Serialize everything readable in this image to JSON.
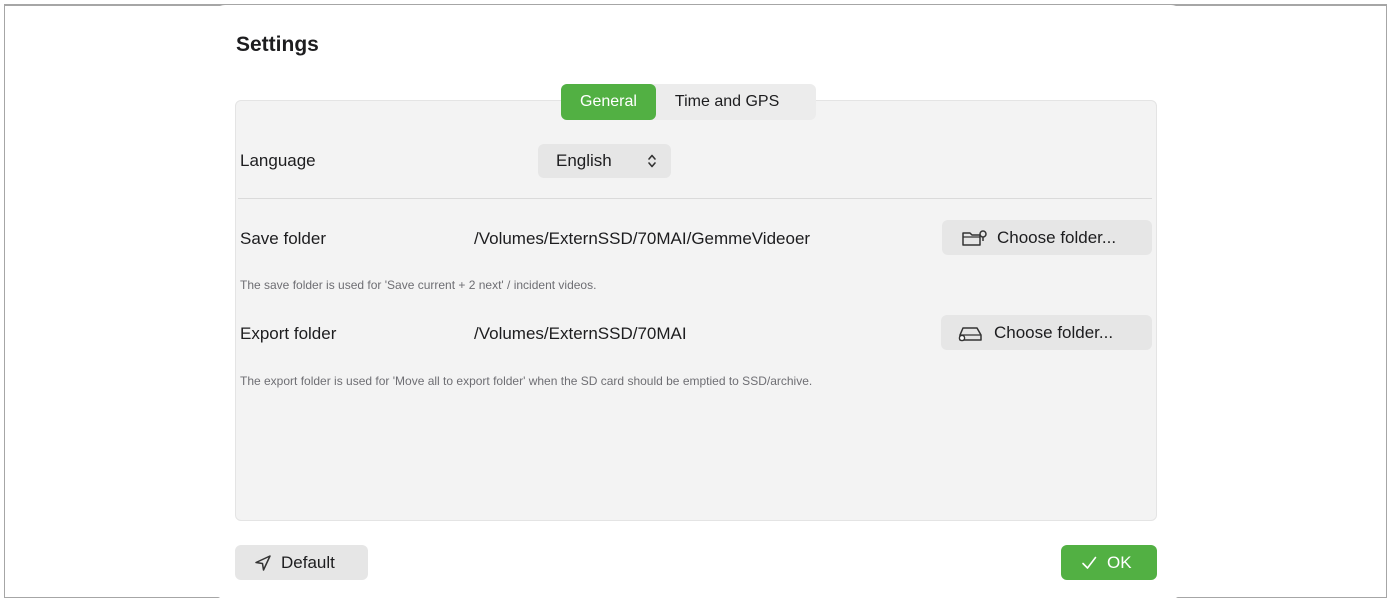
{
  "dialog": {
    "title": "Settings"
  },
  "tabs": [
    {
      "label": "General",
      "active": true
    },
    {
      "label": "Time and GPS",
      "active": false
    }
  ],
  "language": {
    "label": "Language",
    "value": "English"
  },
  "save_folder": {
    "label": "Save folder",
    "path": "/Volumes/ExternSSD/70MAI/GemmeVideoer",
    "button_label": "Choose folder...",
    "hint": "The save folder is used for 'Save current + 2 next' / incident videos."
  },
  "export_folder": {
    "label": "Export folder",
    "path": "/Volumes/ExternSSD/70MAI",
    "button_label": "Choose folder...",
    "hint": "The export folder is used for 'Move all to export folder' when the SD card should be emptied to SSD/archive."
  },
  "footer": {
    "default_label": "Default",
    "ok_label": "OK"
  },
  "colors": {
    "accent": "#52b043",
    "panel": "#f3f3f3",
    "control": "#e6e6e6"
  },
  "icons": {
    "language_select": "chevron-up-down-icon",
    "save_button": "folder-pin-icon",
    "export_button": "external-drive-icon",
    "default_button": "location-arrow-icon",
    "ok_button": "checkmark-icon"
  }
}
